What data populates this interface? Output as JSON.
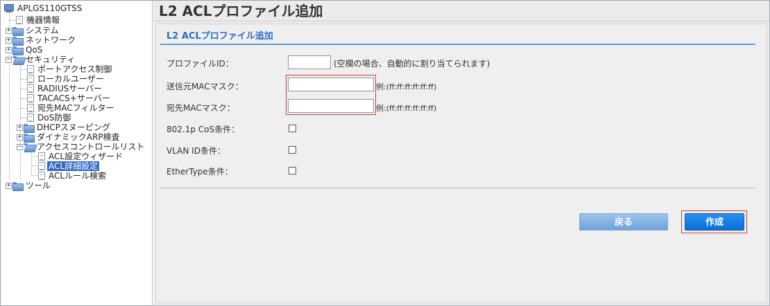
{
  "tree": {
    "root": "APLGS110GTSS",
    "items": [
      {
        "label": "機器情報",
        "kind": "page"
      },
      {
        "label": "システム",
        "kind": "folder"
      },
      {
        "label": "ネットワーク",
        "kind": "folder"
      },
      {
        "label": "QoS",
        "kind": "folder"
      },
      {
        "label": "セキュリティ",
        "kind": "folder-open"
      },
      {
        "label": "ポートアクセス制御",
        "kind": "page"
      },
      {
        "label": "ローカルユーザー",
        "kind": "page"
      },
      {
        "label": "RADIUSサーバー",
        "kind": "page"
      },
      {
        "label": "TACACS+サーバー",
        "kind": "page"
      },
      {
        "label": "宛先MACフィルター",
        "kind": "page"
      },
      {
        "label": "DoS防御",
        "kind": "page"
      },
      {
        "label": "DHCPスヌーピング",
        "kind": "folder"
      },
      {
        "label": "ダイナミックARP検査",
        "kind": "folder"
      },
      {
        "label": "アクセスコントロールリスト",
        "kind": "folder-open"
      },
      {
        "label": "ACL設定ウィザード",
        "kind": "page"
      },
      {
        "label": "ACL詳細設定",
        "kind": "page",
        "selected": true
      },
      {
        "label": "ACLルール検索",
        "kind": "page"
      },
      {
        "label": "ツール",
        "kind": "folder"
      }
    ]
  },
  "main": {
    "page_title": "L2 ACLプロファイル追加",
    "section_title": "L2 ACLプロファイル追加",
    "fields": {
      "profile_id_label": "プロファイルID：",
      "profile_id_value": "",
      "profile_id_hint": "(空欄の場合、自動的に割り当てられます)",
      "src_mac_label": "送信元MACマスク：",
      "src_mac_value": "",
      "src_mac_hint": "例:(ff:ff:ff:ff:ff:ff)",
      "dst_mac_label": "宛先MACマスク：",
      "dst_mac_value": "",
      "dst_mac_hint": "例:(ff:ff:ff:ff:ff:ff)",
      "cos_label": "802.1p CoS条件：",
      "vlan_label": "VLAN ID条件：",
      "ethertype_label": "EtherType条件："
    },
    "buttons": {
      "back": "戻る",
      "create": "作成"
    }
  },
  "colors": {
    "accent": "#2b6fc8",
    "highlight_box": "#d63a3a",
    "selected": "#3369c9"
  }
}
